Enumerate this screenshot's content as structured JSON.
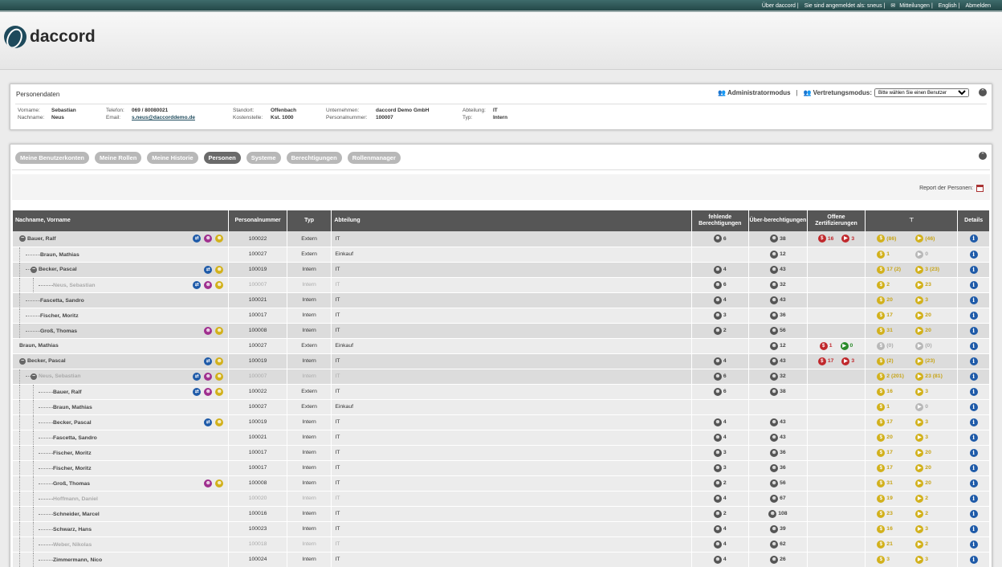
{
  "topbar": {
    "about": "Über daccord",
    "logged_in": "Sie sind angemeldet als: sneus",
    "messages": "Mitteilungen",
    "lang": "English",
    "logout": "Abmelden"
  },
  "logo": {
    "text": "daccord"
  },
  "person_panel": {
    "title": "Personendaten",
    "admin_mode": "Administratormodus",
    "proxy_mode": "Vertretungsmodus:",
    "proxy_select": "Bitte wählen Sie einen Benutzer",
    "fields": [
      [
        {
          "label": "Vorname:",
          "value": "Sebastian"
        },
        {
          "label": "Nachname:",
          "value": "Neus"
        }
      ],
      [
        {
          "label": "Telefon:",
          "value": "069 / 80080021"
        },
        {
          "label": "Email:",
          "value": "s.neus@daccorddemo.de"
        }
      ],
      [
        {
          "label": "Standort:",
          "value": "Offenbach"
        },
        {
          "label": "Kostenstelle:",
          "value": "Kst. 1000"
        }
      ],
      [
        {
          "label": "Unternehmen:",
          "value": "daccord Demo GmbH"
        },
        {
          "label": "Personalnummer:",
          "value": "100007"
        }
      ],
      [
        {
          "label": "Abteilung:",
          "value": "IT"
        },
        {
          "label": "Typ:",
          "value": "Intern"
        }
      ]
    ]
  },
  "tabs": [
    "Meine Benutzerkonten",
    "Meine Rollen",
    "Meine Historie",
    "Personen",
    "Systeme",
    "Berechtigungen",
    "Rollenmanager"
  ],
  "active_tab": "Personen",
  "report_label": "Report der Personen:",
  "columns": [
    "Nachname, Vorname",
    "Personalnummer",
    "Typ",
    "Abteilung",
    "fehlende Berechtigungen",
    "Über-berechtigungen",
    "Offene Zertifizierungen",
    "",
    "Details"
  ],
  "rows": [
    {
      "name": "Bauer, Ralf",
      "level": 0,
      "toggle": true,
      "icons": [
        "blue",
        "purple",
        "yellow"
      ],
      "nr": "100022",
      "typ": "Extern",
      "abt": "IT",
      "fehl": "6",
      "ueber": "38",
      "cert": [
        [
          "red",
          "16"
        ],
        [
          "red",
          "3"
        ]
      ],
      "c1": "(86)",
      "c2": "(46)",
      "grp": "g1"
    },
    {
      "name": "Braun, Mathias",
      "level": 1,
      "icons": [],
      "nr": "100027",
      "typ": "Extern",
      "abt": "Einkauf",
      "fehl": "",
      "ueber": "12",
      "cert": [],
      "c1": "1",
      "c2": "0",
      "c2grey": true,
      "grp": "w"
    },
    {
      "name": "Becker, Pascal",
      "level": 1,
      "toggle": true,
      "icons": [
        "blue",
        "yellow"
      ],
      "nr": "100019",
      "typ": "Intern",
      "abt": "IT",
      "fehl": "4",
      "ueber": "43",
      "cert": [],
      "c1": "17 (2)",
      "c2": "3 (23)",
      "grp": "g1"
    },
    {
      "name": "Neus, Sebastian",
      "level": 2,
      "icons": [
        "blue",
        "purple",
        "yellow"
      ],
      "nr": "100007",
      "typ": "Intern",
      "abt": "IT",
      "fehl": "6",
      "ueber": "32",
      "cert": [],
      "c1": "2",
      "c2": "23",
      "grp": "w",
      "muted": true
    },
    {
      "name": "Fascetta, Sandro",
      "level": 1,
      "icons": [],
      "nr": "100021",
      "typ": "Intern",
      "abt": "IT",
      "fehl": "4",
      "ueber": "43",
      "cert": [],
      "c1": "20",
      "c2": "3",
      "grp": "g1"
    },
    {
      "name": "Fischer, Moritz",
      "level": 1,
      "icons": [],
      "nr": "100017",
      "typ": "Intern",
      "abt": "IT",
      "fehl": "3",
      "ueber": "36",
      "cert": [],
      "c1": "17",
      "c2": "20",
      "grp": "w"
    },
    {
      "name": "Groß, Thomas",
      "level": 1,
      "icons": [
        "purple",
        "yellow"
      ],
      "nr": "100008",
      "typ": "Intern",
      "abt": "IT",
      "fehl": "2",
      "ueber": "56",
      "cert": [],
      "c1": "31",
      "c2": "20",
      "grp": "g1"
    },
    {
      "name": "Braun, Mathias",
      "level": 0,
      "icons": [],
      "nr": "100027",
      "typ": "Extern",
      "abt": "Einkauf",
      "fehl": "",
      "ueber": "12",
      "cert": [
        [
          "red",
          "1"
        ],
        [
          "green",
          "0"
        ]
      ],
      "c1": "(0)",
      "c2": "(0)",
      "c1grey": true,
      "c2grey": true,
      "grp": "w"
    },
    {
      "name": "Becker, Pascal",
      "level": 0,
      "toggle": true,
      "icons": [
        "blue",
        "yellow"
      ],
      "nr": "100019",
      "typ": "Intern",
      "abt": "IT",
      "fehl": "4",
      "ueber": "43",
      "cert": [
        [
          "red",
          "17"
        ],
        [
          "red",
          "3"
        ]
      ],
      "c1": "(2)",
      "c2": "(23)",
      "grp": "g1"
    },
    {
      "name": "Neus, Sebastian",
      "level": 1,
      "toggle": true,
      "icons": [
        "blue",
        "purple",
        "yellow"
      ],
      "nr": "100007",
      "typ": "Intern",
      "abt": "IT",
      "fehl": "6",
      "ueber": "32",
      "cert": [],
      "c1": "2 (201)",
      "c2": "23 (81)",
      "grp": "g1",
      "muted": true
    },
    {
      "name": "Bauer, Ralf",
      "level": 2,
      "icons": [
        "blue",
        "purple",
        "yellow"
      ],
      "nr": "100022",
      "typ": "Extern",
      "abt": "IT",
      "fehl": "6",
      "ueber": "38",
      "cert": [],
      "c1": "16",
      "c2": "3",
      "grp": "w"
    },
    {
      "name": "Braun, Mathias",
      "level": 2,
      "icons": [],
      "nr": "100027",
      "typ": "Extern",
      "abt": "Einkauf",
      "fehl": "",
      "ueber": "",
      "cert": [],
      "c1": "1",
      "c2": "0",
      "c2grey": true,
      "grp": "w"
    },
    {
      "name": "Becker, Pascal",
      "level": 2,
      "icons": [
        "blue",
        "yellow"
      ],
      "nr": "100019",
      "typ": "Intern",
      "abt": "IT",
      "fehl": "4",
      "ueber": "43",
      "cert": [],
      "c1": "17",
      "c2": "3",
      "grp": "w"
    },
    {
      "name": "Fascetta, Sandro",
      "level": 2,
      "icons": [],
      "nr": "100021",
      "typ": "Intern",
      "abt": "IT",
      "fehl": "4",
      "ueber": "43",
      "cert": [],
      "c1": "20",
      "c2": "3",
      "grp": "w"
    },
    {
      "name": "Fischer, Moritz",
      "level": 2,
      "icons": [],
      "nr": "100017",
      "typ": "Intern",
      "abt": "IT",
      "fehl": "3",
      "ueber": "36",
      "cert": [],
      "c1": "17",
      "c2": "20",
      "grp": "w"
    },
    {
      "name": "Fischer, Moritz",
      "level": 2,
      "icons": [],
      "nr": "100017",
      "typ": "Intern",
      "abt": "IT",
      "fehl": "3",
      "ueber": "36",
      "cert": [],
      "c1": "17",
      "c2": "20",
      "grp": "w"
    },
    {
      "name": "Groß, Thomas",
      "level": 2,
      "icons": [
        "purple",
        "yellow"
      ],
      "nr": "100008",
      "typ": "Intern",
      "abt": "IT",
      "fehl": "2",
      "ueber": "56",
      "cert": [],
      "c1": "31",
      "c2": "20",
      "grp": "w"
    },
    {
      "name": "Hoffmann, Daniel",
      "level": 2,
      "icons": [],
      "nr": "100020",
      "typ": "Intern",
      "abt": "IT",
      "fehl": "4",
      "ueber": "67",
      "cert": [],
      "c1": "19",
      "c2": "2",
      "grp": "w",
      "muted": true
    },
    {
      "name": "Schneider, Marcel",
      "level": 2,
      "icons": [],
      "nr": "100016",
      "typ": "Intern",
      "abt": "IT",
      "fehl": "2",
      "ueber": "108",
      "cert": [],
      "c1": "23",
      "c2": "2",
      "grp": "w"
    },
    {
      "name": "Schwarz, Hans",
      "level": 2,
      "icons": [],
      "nr": "100023",
      "typ": "Intern",
      "abt": "IT",
      "fehl": "4",
      "ueber": "39",
      "cert": [],
      "c1": "16",
      "c2": "3",
      "grp": "w"
    },
    {
      "name": "Weber, Nikolas",
      "level": 2,
      "icons": [],
      "nr": "100018",
      "typ": "Intern",
      "abt": "IT",
      "fehl": "4",
      "ueber": "62",
      "cert": [],
      "c1": "21",
      "c2": "2",
      "grp": "w",
      "muted": true
    },
    {
      "name": "Zimmermann, Nico",
      "level": 2,
      "icons": [],
      "nr": "100024",
      "typ": "Intern",
      "abt": "IT",
      "fehl": "4",
      "ueber": "26",
      "cert": [],
      "c1": "3",
      "c2": "3",
      "grp": "w"
    }
  ]
}
